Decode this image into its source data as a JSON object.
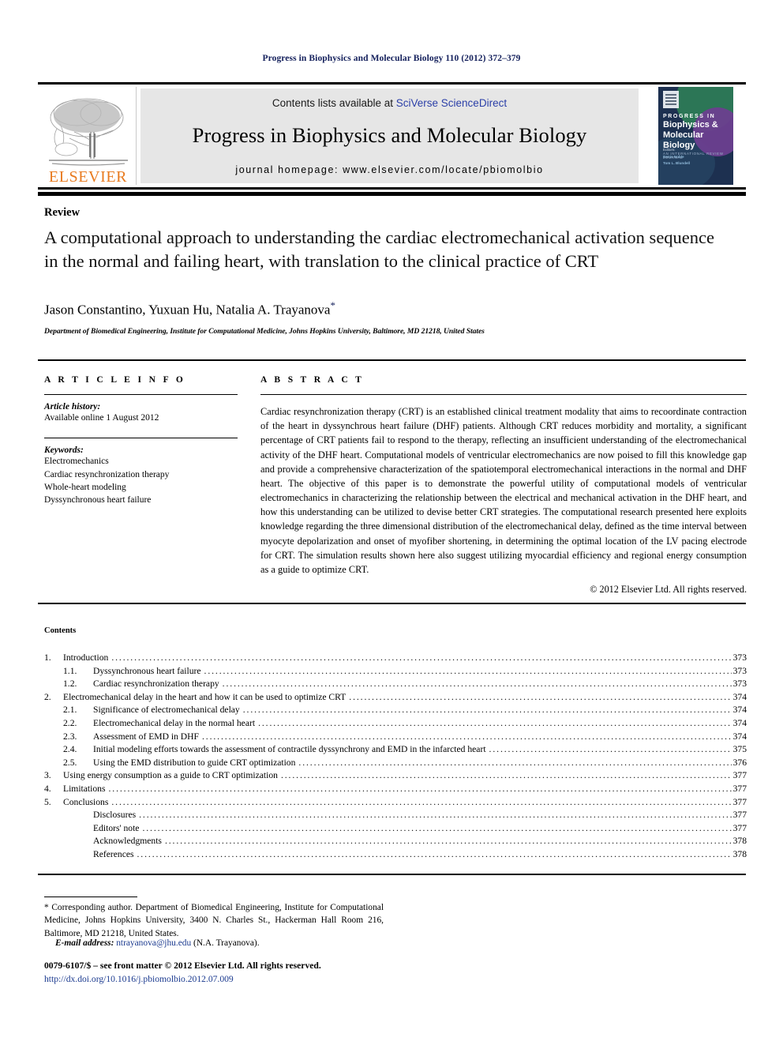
{
  "running_head": "Progress in Biophysics and Molecular Biology 110 (2012) 372–379",
  "masthead": {
    "publisher_wordmark": "ELSEVIER",
    "contents_prefix": "Contents lists available at ",
    "contents_link": "SciVerse ScienceDirect",
    "journal_title": "Progress in Biophysics and Molecular Biology",
    "homepage_prefix": "journal homepage: ",
    "homepage_url": "www.elsevier.com/locate/pbiomolbio",
    "cover": {
      "line1": "PROGRESS IN",
      "line2": "Biophysics & Molecular Biology",
      "line3": "AN INTERNATIONAL REVIEW JOURNAL",
      "editors_label": "Editors:",
      "editor1": "Denis Noble",
      "editor2": "Tom L. Blundell"
    },
    "colors": {
      "brand_orange": "#e87a1e",
      "link_blue": "#2b3fa8",
      "panel_grey": "#e6e6e6",
      "cover_navy": "#1d3050"
    }
  },
  "article": {
    "doctype": "Review",
    "title": "A computational approach to understanding the cardiac electromechanical activation sequence in the normal and failing heart, with translation to the clinical practice of CRT",
    "authors": "Jason Constantino, Yuxuan Hu, Natalia A. Trayanova",
    "corresponding_marker": "*",
    "affiliation": "Department of Biomedical Engineering, Institute for Computational Medicine, Johns Hopkins University, Baltimore, MD 21218, United States"
  },
  "article_info": {
    "heading": "A R T I C L E   I N F O",
    "history_label": "Article history:",
    "history_value": "Available online 1 August 2012",
    "keywords_label": "Keywords:",
    "keywords": [
      "Electromechanics",
      "Cardiac resynchronization therapy",
      "Whole-heart modeling",
      "Dyssynchronous heart failure"
    ]
  },
  "abstract": {
    "heading": "A B S T R A C T",
    "text": "Cardiac resynchronization therapy (CRT) is an established clinical treatment modality that aims to recoordinate contraction of the heart in dyssynchrous heart failure (DHF) patients. Although CRT reduces morbidity and mortality, a significant percentage of CRT patients fail to respond to the therapy, reflecting an insufficient understanding of the electromechanical activity of the DHF heart. Computational models of ventricular electromechanics are now poised to fill this knowledge gap and provide a comprehensive characterization of the spatiotemporal electromechanical interactions in the normal and DHF heart. The objective of this paper is to demonstrate the powerful utility of computational models of ventricular electromechanics in characterizing the relationship between the electrical and mechanical activation in the DHF heart, and how this understanding can be utilized to devise better CRT strategies. The computational research presented here exploits knowledge regarding the three dimensional distribution of the electromechanical delay, defined as the time interval between myocyte depolarization and onset of myofiber shortening, in determining the optimal location of the LV pacing electrode for CRT. The simulation results shown here also suggest utilizing myocardial efficiency and regional energy consumption as a guide to optimize CRT.",
    "copyright": "© 2012 Elsevier Ltd. All rights reserved."
  },
  "contents": {
    "heading": "Contents",
    "entries": [
      {
        "level": 1,
        "num": "1.",
        "label": "Introduction",
        "page": "373"
      },
      {
        "level": 2,
        "num": "1.1.",
        "label": "Dyssynchronous heart failure",
        "page": "373"
      },
      {
        "level": 2,
        "num": "1.2.",
        "label": "Cardiac resynchronization therapy",
        "page": "373"
      },
      {
        "level": 1,
        "num": "2.",
        "label": "Electromechanical delay in the heart and how it can be used to optimize CRT",
        "page": "374"
      },
      {
        "level": 2,
        "num": "2.1.",
        "label": "Significance of electromechanical delay",
        "page": "374"
      },
      {
        "level": 2,
        "num": "2.2.",
        "label": "Electromechanical delay in the normal heart",
        "page": "374"
      },
      {
        "level": 2,
        "num": "2.3.",
        "label": "Assessment of EMD in DHF",
        "page": "374"
      },
      {
        "level": 2,
        "num": "2.4.",
        "label": "Initial modeling efforts towards the assessment of contractile dyssynchrony and EMD in the infarcted heart",
        "page": "375"
      },
      {
        "level": 2,
        "num": "2.5.",
        "label": "Using the EMD distribution to guide CRT optimization",
        "page": "376"
      },
      {
        "level": 1,
        "num": "3.",
        "label": "Using energy consumption as a guide to CRT optimization",
        "page": "377"
      },
      {
        "level": 1,
        "num": "4.",
        "label": "Limitations",
        "page": "377"
      },
      {
        "level": 1,
        "num": "5.",
        "label": "Conclusions",
        "page": "377"
      },
      {
        "level": 2,
        "num": "",
        "label": "Disclosures",
        "page": "377"
      },
      {
        "level": 2,
        "num": "",
        "label": "Editors' note",
        "page": "377"
      },
      {
        "level": 2,
        "num": "",
        "label": "Acknowledgments",
        "page": "378"
      },
      {
        "level": 2,
        "num": "",
        "label": "References",
        "page": "378"
      }
    ]
  },
  "footer": {
    "corresponding": "* Corresponding author. Department of Biomedical Engineering, Institute for Computational Medicine, Johns Hopkins University, 3400 N. Charles St., Hackerman Hall Room 216, Baltimore, MD 21218, United States.",
    "email_label": "E-mail address:",
    "email": "ntrayanova@jhu.edu",
    "email_suffix": "(N.A. Trayanova).",
    "frontmatter": "0079-6107/$ – see front matter © 2012 Elsevier Ltd. All rights reserved.",
    "doi": "http://dx.doi.org/10.1016/j.pbiomolbio.2012.07.009"
  }
}
